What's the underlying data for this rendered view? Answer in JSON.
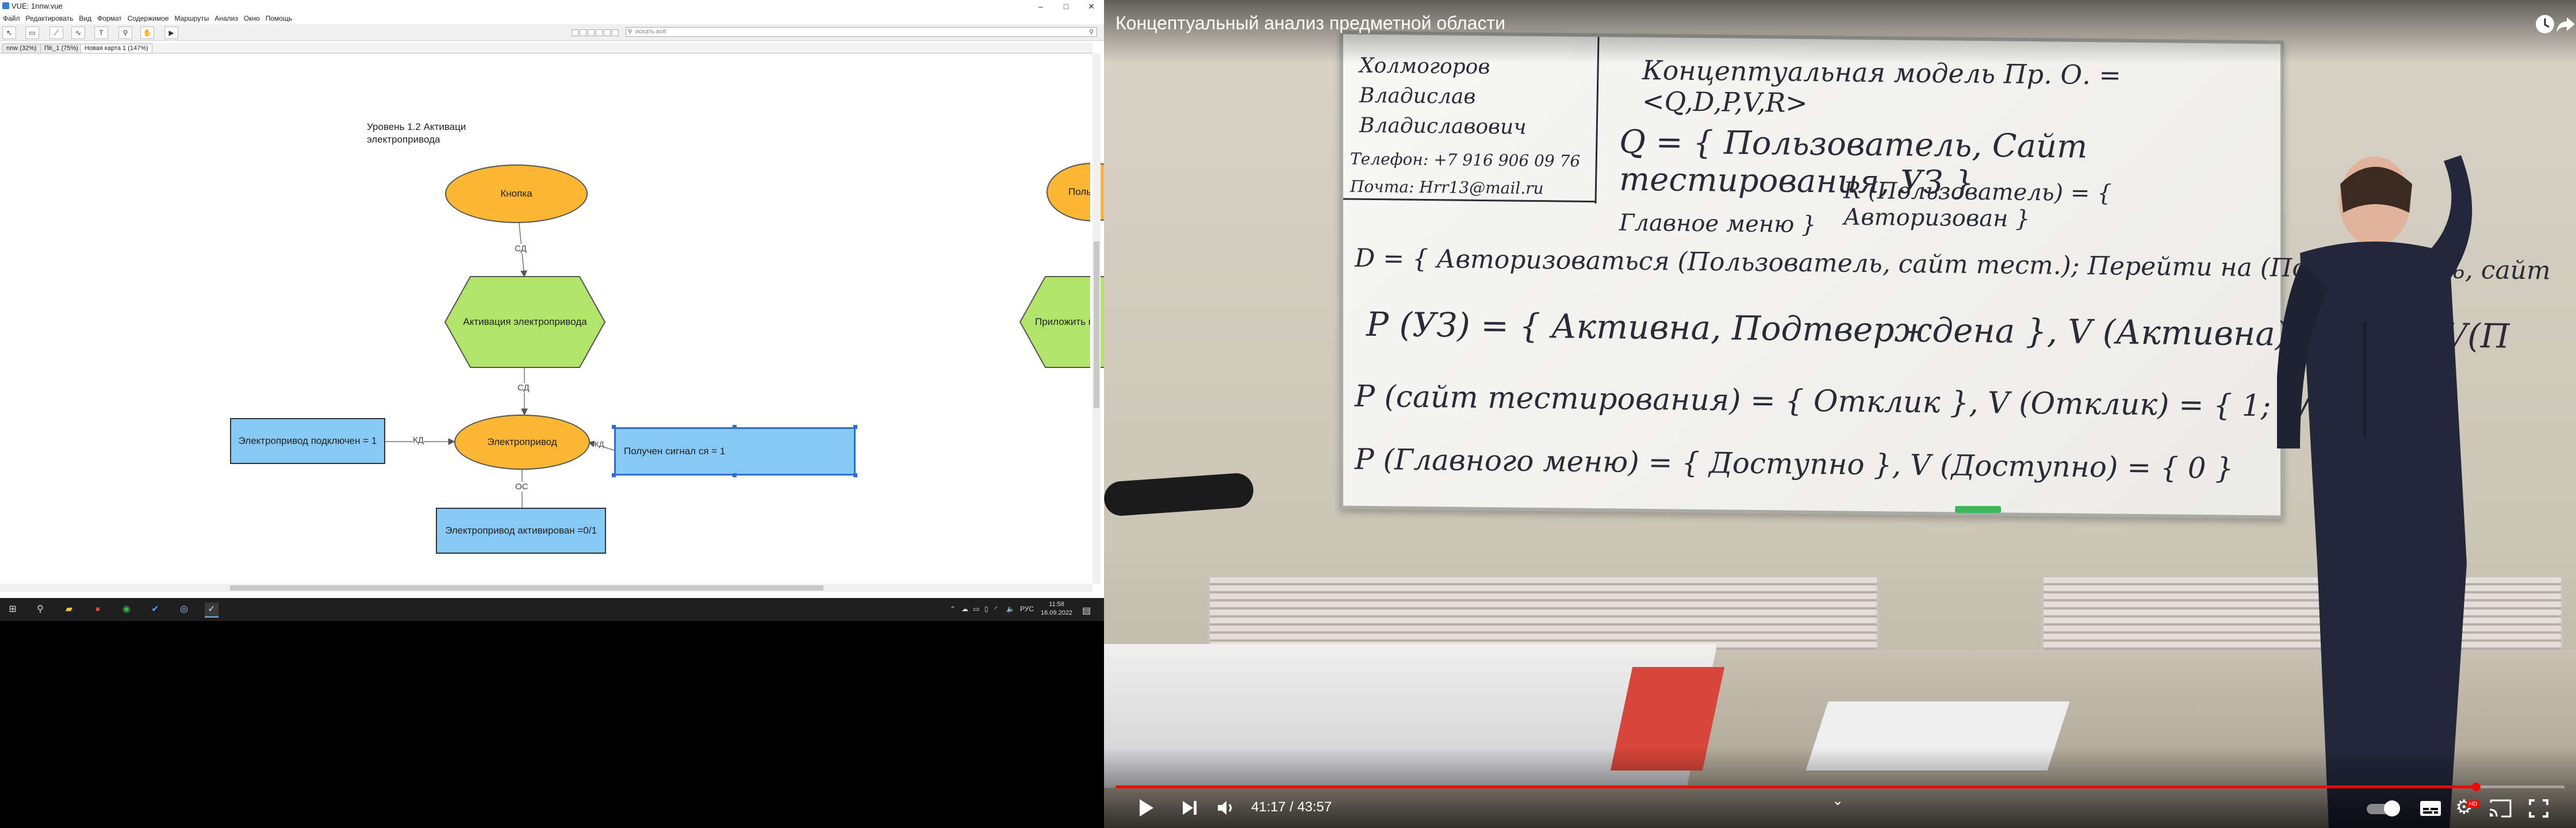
{
  "vue": {
    "window_title": "VUE: 1nnw.vue",
    "menu": [
      "Файл",
      "Редактировать",
      "Вид",
      "Формат",
      "Содержимое",
      "Маршруты",
      "Анализ",
      "Окно",
      "Помощь"
    ],
    "search_placeholder": "искать всё",
    "tabs": [
      "nnw (32%)",
      "ПК_1 (75%)",
      "Новая карта 1 (147%)"
    ],
    "diagram": {
      "level_label_line1": "Уровень 1.2 Активаци",
      "level_label_line2": "электропривода",
      "node_button": "Кнопка",
      "node_activation": "Активация электропривода",
      "node_drive": "Электропривод",
      "node_connected": "Электропривод подключен = 1",
      "node_signal": "Получен сигнал  ся  = 1",
      "node_activated": "Электропривод активирован =0/1",
      "node_right_partial": "Поль",
      "node_right_hex_partial": "Приложить к",
      "edge_sd1": "СД",
      "edge_sd2": "СД",
      "edge_kd1": "КД",
      "edge_kd2": "КД",
      "edge_os": "ОС"
    }
  },
  "taskbar": {
    "lang": "РУС",
    "time": "11:58",
    "date": "16.09.2022"
  },
  "video": {
    "title": "Концептуальный анализ предметной области",
    "time_display": "41:17 / 43:57",
    "progress_fraction": 0.939,
    "accent": "#ff0000",
    "hd_badge": "HD",
    "icons": [
      "clock-icon",
      "share-icon",
      "play-icon",
      "next-icon",
      "volume-icon",
      "chevron-down-icon",
      "autoplay-toggle-icon",
      "subtitles-icon",
      "settings-icon",
      "cast-icon",
      "fullscreen-icon"
    ],
    "board": {
      "author_line1": "Холмогоров",
      "author_line2": "Владислав",
      "author_line3": "Владиславович",
      "phone": "Телефон: +7 916 906 09 76",
      "mail": "Почта: Hrr13@mail.ru",
      "heading": "Концептуальная модель Пр. О. = <Q,D,P,V,R>",
      "line_q": "Q = { Пользователь, Сайт тестирования, УЗ }",
      "line_r": "R (Пользователь) = { Авторизован }",
      "line_menu": "Главное меню }",
      "line_d": "D = { Авторизоваться (Пользователь, сайт тест.); Перейти на (Пользователь, сайт",
      "line_p1": "P (УЗ) = { Активна, Подтверждена }, V (Активна) = { 1 }, V(П",
      "line_p2": "P (сайт тестирования) = { Отклик }, V (Отклик) = { 1; 0/1 }",
      "line_p3": "P (Главного меню) = { Доступно }, V (Доступно) = { 0 }"
    }
  }
}
